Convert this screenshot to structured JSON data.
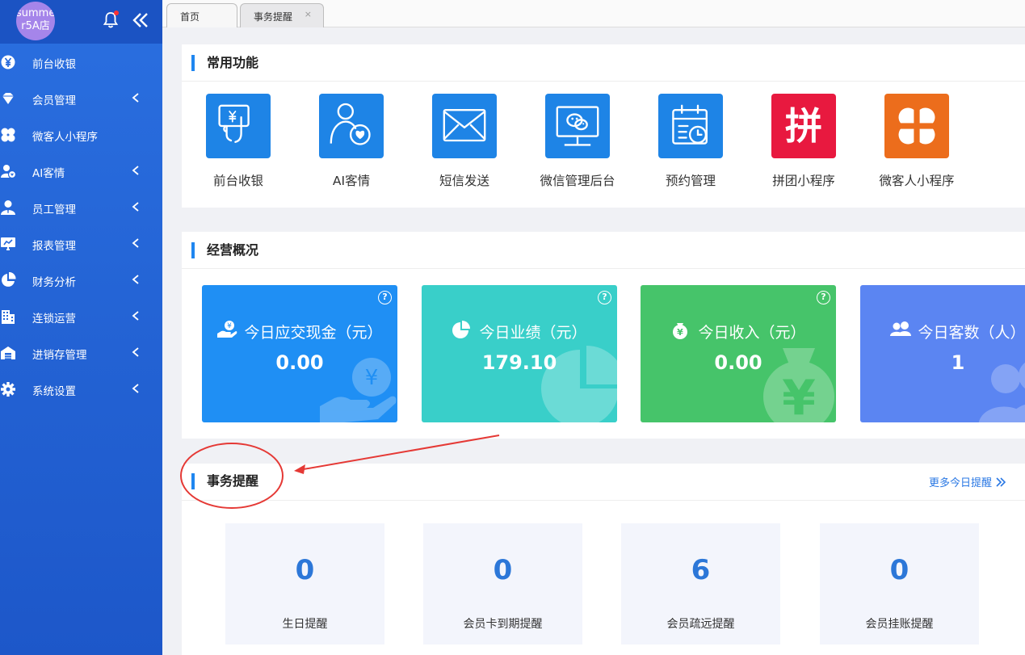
{
  "sidebar": {
    "store_name_line1": "summe",
    "store_name_line2": "r5A店",
    "items": [
      {
        "label": "前台收银",
        "icon": "yen-circle-icon",
        "has_submenu": false
      },
      {
        "label": "会员管理",
        "icon": "diamond-icon",
        "has_submenu": true
      },
      {
        "label": "微客人小程序",
        "icon": "clover-icon",
        "has_submenu": false
      },
      {
        "label": "AI客情",
        "icon": "user-heart-icon",
        "has_submenu": true
      },
      {
        "label": "员工管理",
        "icon": "user-tie-icon",
        "has_submenu": true
      },
      {
        "label": "报表管理",
        "icon": "monitor-chart-icon",
        "has_submenu": true
      },
      {
        "label": "财务分析",
        "icon": "pie-chart-icon",
        "has_submenu": true
      },
      {
        "label": "连锁运营",
        "icon": "building-icon",
        "has_submenu": true
      },
      {
        "label": "进销存管理",
        "icon": "warehouse-icon",
        "has_submenu": true
      },
      {
        "label": "系统设置",
        "icon": "gear-icon",
        "has_submenu": true
      }
    ]
  },
  "tabs": [
    {
      "label": "首页",
      "closable": false
    },
    {
      "label": "事务提醒",
      "closable": true,
      "close_glyph": "×"
    }
  ],
  "common_functions": {
    "title": "常用功能",
    "items": [
      {
        "label": "前台收银",
        "icon": "cashier-hand-icon",
        "color": "#1e84e6"
      },
      {
        "label": "AI客情",
        "icon": "user-heart-icon",
        "color": "#1e84e6"
      },
      {
        "label": "短信发送",
        "icon": "envelope-icon",
        "color": "#1e84e6"
      },
      {
        "label": "微信管理后台",
        "icon": "wechat-monitor-icon",
        "color": "#1e84e6"
      },
      {
        "label": "预约管理",
        "icon": "calendar-clock-icon",
        "color": "#1e84e6"
      },
      {
        "label": "拼团小程序",
        "icon": "pin-text-icon",
        "color": "#e8193f",
        "glyph": "拼"
      },
      {
        "label": "微客人小程序",
        "icon": "clover-icon",
        "color": "#ec6d1c"
      }
    ]
  },
  "overview": {
    "title": "经营概况",
    "stats": [
      {
        "label": "今日应交现金（元）",
        "value": "0.00",
        "color": "#1f8ff4",
        "icon": "hand-coin-icon"
      },
      {
        "label": "今日业绩（元）",
        "value": "179.10",
        "color": "#39cfc9",
        "icon": "pie-chart-icon"
      },
      {
        "label": "今日收入（元）",
        "value": "0.00",
        "color": "#46c46a",
        "icon": "money-bag-icon"
      },
      {
        "label": "今日客数（人）",
        "value": "1",
        "color": "#5b85f2",
        "icon": "users-icon"
      }
    ]
  },
  "reminders": {
    "title": "事务提醒",
    "more_link": "更多今日提醒",
    "items": [
      {
        "label": "生日提醒",
        "count": "0"
      },
      {
        "label": "会员卡到期提醒",
        "count": "0"
      },
      {
        "label": "会员疏远提醒",
        "count": "6"
      },
      {
        "label": "会员挂账提醒",
        "count": "0"
      }
    ]
  },
  "colors": {
    "sidebar_bg": "#2568dc",
    "accent": "#1f86f0",
    "annotation_red": "#e53935"
  }
}
